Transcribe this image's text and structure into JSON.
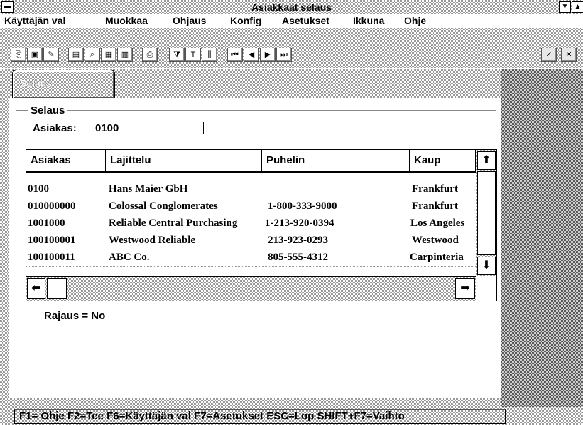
{
  "window": {
    "title": "Asiakkaat selaus"
  },
  "menubar": {
    "items": [
      "Käyttäjän val",
      "Muokkaa",
      "Ohjaus",
      "Konfig",
      "Asetukset",
      "Ikkuna",
      "Ohje"
    ]
  },
  "tabs": {
    "active": "Selaus"
  },
  "form": {
    "group_label": "Selaus",
    "asiakas_label": "Asiakas:",
    "asiakas_value": "0100",
    "filter_text": "Rajaus = No"
  },
  "table": {
    "columns": [
      "Asiakas",
      "Lajittelu",
      "Puhelin",
      "Kaup"
    ],
    "rows": [
      {
        "asiakas": "0100",
        "lajittelu": "Hans Maier GbH",
        "puhelin": "",
        "kaup": "Frankfurt"
      },
      {
        "asiakas": "010000000",
        "lajittelu": "Colossal Conglomerates",
        "puhelin": "1-800-333-9000",
        "kaup": "Frankfurt"
      },
      {
        "asiakas": "1001000",
        "lajittelu": "Reliable Central Purchasing",
        "puhelin": "1-213-920-0394",
        "kaup": "Los Angeles"
      },
      {
        "asiakas": "100100001",
        "lajittelu": "Westwood Reliable",
        "puhelin": "213-923-0293",
        "kaup": "Westwood"
      },
      {
        "asiakas": "100100011",
        "lajittelu": "ABC Co.",
        "puhelin": "805-555-4312",
        "kaup": "Carpinteria"
      }
    ]
  },
  "statusbar": {
    "text": "F1= Ohje F2=Tee  F6=Käyttäjän val  F7=Asetukset  ESC=Lop  SHIFT+F7=Vaihto"
  }
}
